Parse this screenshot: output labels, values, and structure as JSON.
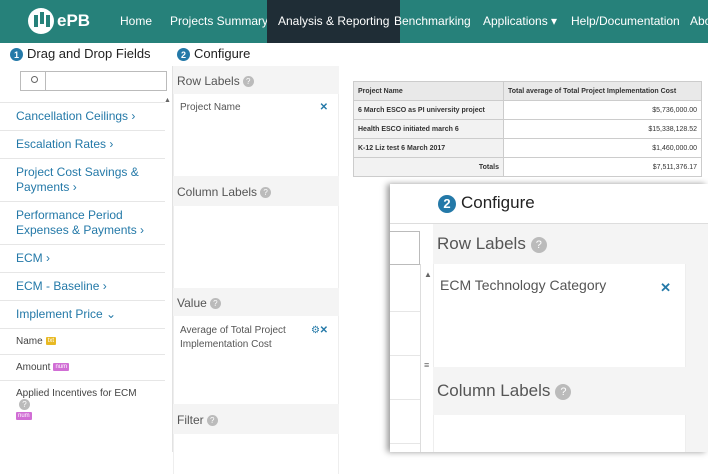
{
  "nav": {
    "brand": "ePB",
    "items": [
      "Home",
      "Projects Summary",
      "Analysis & Reporting",
      "Benchmarking",
      "Applications ▾",
      "Help/Documentation",
      "Abo"
    ],
    "active_index": 2
  },
  "drag": {
    "step": "1",
    "title": "Drag and Drop Fields"
  },
  "configure": {
    "step": "2",
    "title": "Configure"
  },
  "fields": [
    "Cancellation Ceilings ›",
    "Escalation Rates ›",
    "Project Cost Savings & Payments ›",
    "Performance Period Expenses & Payments ›",
    "ECM ›",
    "ECM - Baseline ›",
    "Implement Price ⌄"
  ],
  "subfields": [
    {
      "label": "Name",
      "tag": "txt"
    },
    {
      "label": "Amount",
      "tag": "num"
    },
    {
      "label": "Applied Incentives for ECM",
      "tag": "num"
    }
  ],
  "zones": {
    "row_labels": {
      "title": "Row Labels",
      "value": "Project Name"
    },
    "column_labels": {
      "title": "Column Labels"
    },
    "value": {
      "title": "Value",
      "value": "Average of Total Project Implementation Cost"
    },
    "filter": {
      "title": "Filter"
    }
  },
  "table": {
    "headers": [
      "Project Name",
      "Total average of Total Project Implementation Cost"
    ],
    "rows": [
      [
        "6 March ESCO as PI university project",
        "$5,736,000.00"
      ],
      [
        "Health ESCO initiated march 6",
        "$15,338,128.52"
      ],
      [
        "K-12 Liz test 6 March 2017",
        "$1,460,000.00"
      ],
      [
        "Totals",
        "$7,511,376.17"
      ]
    ]
  },
  "zoom": {
    "step": "2",
    "title": "Configure",
    "row_labels": "Row Labels",
    "row_value": "ECM Technology Category",
    "column_labels": "Column Labels"
  },
  "colors": {
    "nav": "#26817a",
    "nav_active": "#1f2d36",
    "accent": "#2479a8",
    "tag_txt": "#e8b923",
    "tag_num": "#d16ed5"
  }
}
